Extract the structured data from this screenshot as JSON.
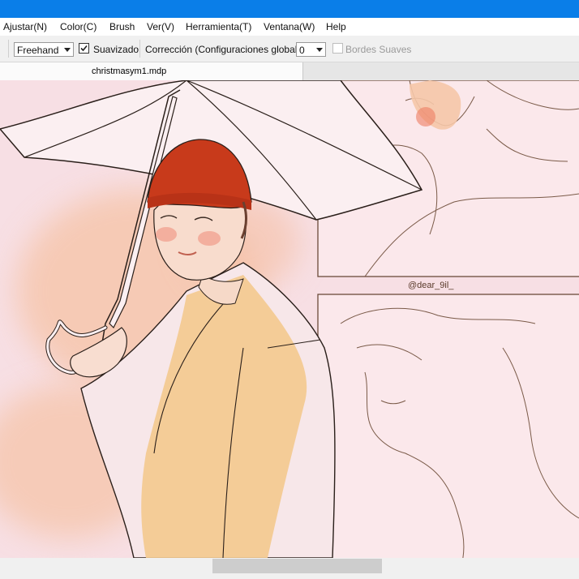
{
  "menu": [
    "Ajustar(N)",
    "Color(C)",
    "Brush",
    "Ver(V)",
    "Herramienta(T)",
    "Ventana(W)",
    "Help"
  ],
  "toolbar": {
    "brush_mode": "Freehand",
    "smoothing_label": "Suavizado",
    "smoothing_checked": true,
    "correction_label": "Corrección (Configuraciones globales)",
    "correction_value": "0",
    "soft_edges_label": "Bordes Suaves",
    "soft_edges_enabled": false
  },
  "tab": {
    "title": "christmasym1.mdp"
  },
  "canvas": {
    "watermark": "@dear_9il_",
    "background_color": "#f7dfe4",
    "hat_color": "#c83a1b",
    "coat_color": "#f3c98e"
  },
  "colors": {
    "titlebar": "#0a7ee8"
  }
}
